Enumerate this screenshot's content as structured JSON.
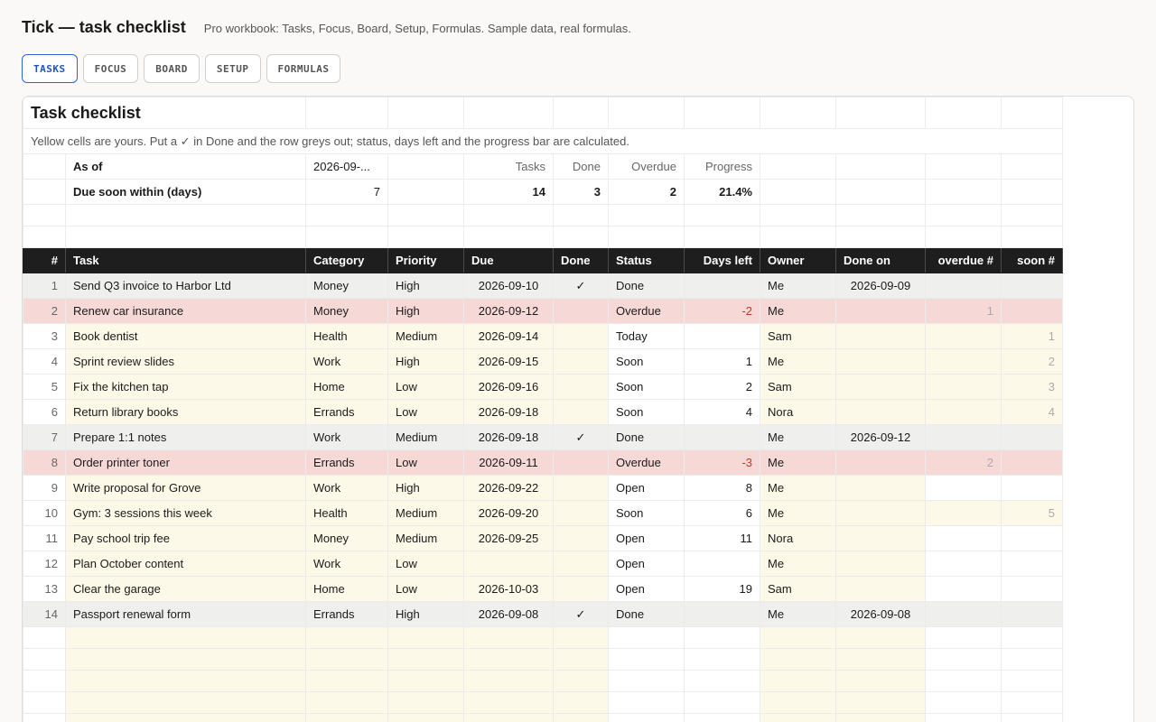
{
  "app": {
    "title": "Tick — task checklist",
    "subtitle": "Pro workbook: Tasks, Focus, Board, Setup, Formulas. Sample data, real formulas."
  },
  "tabs": [
    {
      "label": "TASKS",
      "active": true
    },
    {
      "label": "FOCUS",
      "active": false
    },
    {
      "label": "BOARD",
      "active": false
    },
    {
      "label": "SETUP",
      "active": false
    },
    {
      "label": "FORMULAS",
      "active": false
    }
  ],
  "sheet": {
    "title": "Task checklist",
    "description": "Yellow cells are yours. Put a ✓ in Done and the row greys out; status, days left and the progress bar are calculated.",
    "summary": {
      "as_of_label": "As of",
      "as_of_value": "2026-09-...",
      "due_soon_label": "Due soon within (days)",
      "due_soon_value": "7",
      "tasks_label": "Tasks",
      "tasks_value": "14",
      "done_label": "Done",
      "done_value": "3",
      "overdue_label": "Overdue",
      "overdue_value": "2",
      "progress_label": "Progress",
      "progress_value": "21.4%"
    },
    "columns": [
      "#",
      "Task",
      "Category",
      "Priority",
      "Due",
      "Done",
      "Status",
      "Days left",
      "Owner",
      "Done on",
      "overdue #",
      "soon #"
    ],
    "rows": [
      {
        "n": "1",
        "task": "Send Q3 invoice to Harbor Ltd",
        "category": "Money",
        "priority": "High",
        "due": "2026-09-10",
        "done": "✓",
        "status": "Done",
        "days_left": "",
        "owner": "Me",
        "done_on": "2026-09-09",
        "overdue_n": "",
        "soon_n": ""
      },
      {
        "n": "2",
        "task": "Renew car insurance",
        "category": "Money",
        "priority": "High",
        "due": "2026-09-12",
        "done": "",
        "status": "Overdue",
        "days_left": "-2",
        "owner": "Me",
        "done_on": "",
        "overdue_n": "1",
        "soon_n": ""
      },
      {
        "n": "3",
        "task": "Book dentist",
        "category": "Health",
        "priority": "Medium",
        "due": "2026-09-14",
        "done": "",
        "status": "Today",
        "days_left": "",
        "owner": "Sam",
        "done_on": "",
        "overdue_n": "",
        "soon_n": "1"
      },
      {
        "n": "4",
        "task": "Sprint review slides",
        "category": "Work",
        "priority": "High",
        "due": "2026-09-15",
        "done": "",
        "status": "Soon",
        "days_left": "1",
        "owner": "Me",
        "done_on": "",
        "overdue_n": "",
        "soon_n": "2"
      },
      {
        "n": "5",
        "task": "Fix the kitchen tap",
        "category": "Home",
        "priority": "Low",
        "due": "2026-09-16",
        "done": "",
        "status": "Soon",
        "days_left": "2",
        "owner": "Sam",
        "done_on": "",
        "overdue_n": "",
        "soon_n": "3"
      },
      {
        "n": "6",
        "task": "Return library books",
        "category": "Errands",
        "priority": "Low",
        "due": "2026-09-18",
        "done": "",
        "status": "Soon",
        "days_left": "4",
        "owner": "Nora",
        "done_on": "",
        "overdue_n": "",
        "soon_n": "4"
      },
      {
        "n": "7",
        "task": "Prepare 1:1 notes",
        "category": "Work",
        "priority": "Medium",
        "due": "2026-09-18",
        "done": "✓",
        "status": "Done",
        "days_left": "",
        "owner": "Me",
        "done_on": "2026-09-12",
        "overdue_n": "",
        "soon_n": ""
      },
      {
        "n": "8",
        "task": "Order printer toner",
        "category": "Errands",
        "priority": "Low",
        "due": "2026-09-11",
        "done": "",
        "status": "Overdue",
        "days_left": "-3",
        "owner": "Me",
        "done_on": "",
        "overdue_n": "2",
        "soon_n": ""
      },
      {
        "n": "9",
        "task": "Write proposal for Grove",
        "category": "Work",
        "priority": "High",
        "due": "2026-09-22",
        "done": "",
        "status": "Open",
        "days_left": "8",
        "owner": "Me",
        "done_on": "",
        "overdue_n": "",
        "soon_n": ""
      },
      {
        "n": "10",
        "task": "Gym: 3 sessions this week",
        "category": "Health",
        "priority": "Medium",
        "due": "2026-09-20",
        "done": "",
        "status": "Soon",
        "days_left": "6",
        "owner": "Me",
        "done_on": "",
        "overdue_n": "",
        "soon_n": "5"
      },
      {
        "n": "11",
        "task": "Pay school trip fee",
        "category": "Money",
        "priority": "Medium",
        "due": "2026-09-25",
        "done": "",
        "status": "Open",
        "days_left": "11",
        "owner": "Nora",
        "done_on": "",
        "overdue_n": "",
        "soon_n": ""
      },
      {
        "n": "12",
        "task": "Plan October content",
        "category": "Work",
        "priority": "Low",
        "due": "",
        "done": "",
        "status": "Open",
        "days_left": "",
        "owner": "Me",
        "done_on": "",
        "overdue_n": "",
        "soon_n": ""
      },
      {
        "n": "13",
        "task": "Clear the garage",
        "category": "Home",
        "priority": "Low",
        "due": "2026-10-03",
        "done": "",
        "status": "Open",
        "days_left": "19",
        "owner": "Sam",
        "done_on": "",
        "overdue_n": "",
        "soon_n": ""
      },
      {
        "n": "14",
        "task": "Passport renewal form",
        "category": "Errands",
        "priority": "High",
        "due": "2026-09-08",
        "done": "✓",
        "status": "Done",
        "days_left": "",
        "owner": "Me",
        "done_on": "2026-09-08",
        "overdue_n": "",
        "soon_n": ""
      }
    ],
    "colors": {
      "done_row": "#efefed",
      "overdue_row": "#f6d9d6",
      "input_cell": "#fdf9e8",
      "header": "#1e1e1e",
      "active_tab": "#2f63d6"
    }
  }
}
